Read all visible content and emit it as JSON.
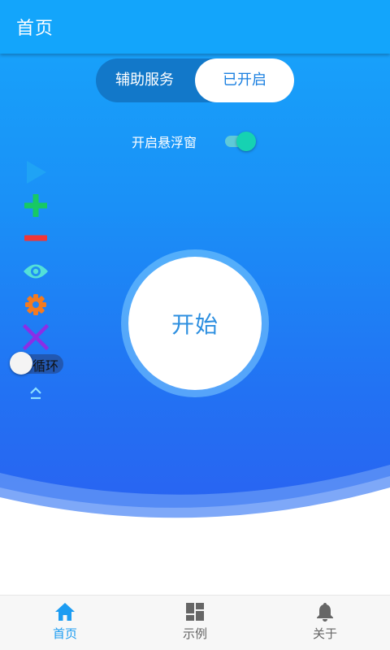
{
  "appbar": {
    "title": "首页"
  },
  "service": {
    "label": "辅助服务",
    "state": "已开启"
  },
  "float_window": {
    "label": "开启悬浮窗",
    "enabled": true
  },
  "toolbar": {
    "icons": [
      "play-icon",
      "plus-icon",
      "minus-icon",
      "eye-icon",
      "gear-icon",
      "close-icon",
      "chevron-up-icon"
    ],
    "colors": {
      "play": "#1fa3f5",
      "plus": "#17c964",
      "minus": "#f03636",
      "eye": "#53e0d8",
      "gear": "#f47a1f",
      "close": "#8b2ee6",
      "chevron": "#8fe0ff"
    }
  },
  "loop": {
    "label": "循环",
    "enabled": false
  },
  "start_button": {
    "label": "开始"
  },
  "bottom_nav": {
    "items": [
      {
        "label": "首页",
        "icon": "home-icon",
        "active": true
      },
      {
        "label": "示例",
        "icon": "grid-icon",
        "active": false
      },
      {
        "label": "关于",
        "icon": "bell-icon",
        "active": false
      }
    ],
    "active_color": "#1c9cf2",
    "inactive_color": "#666666"
  }
}
